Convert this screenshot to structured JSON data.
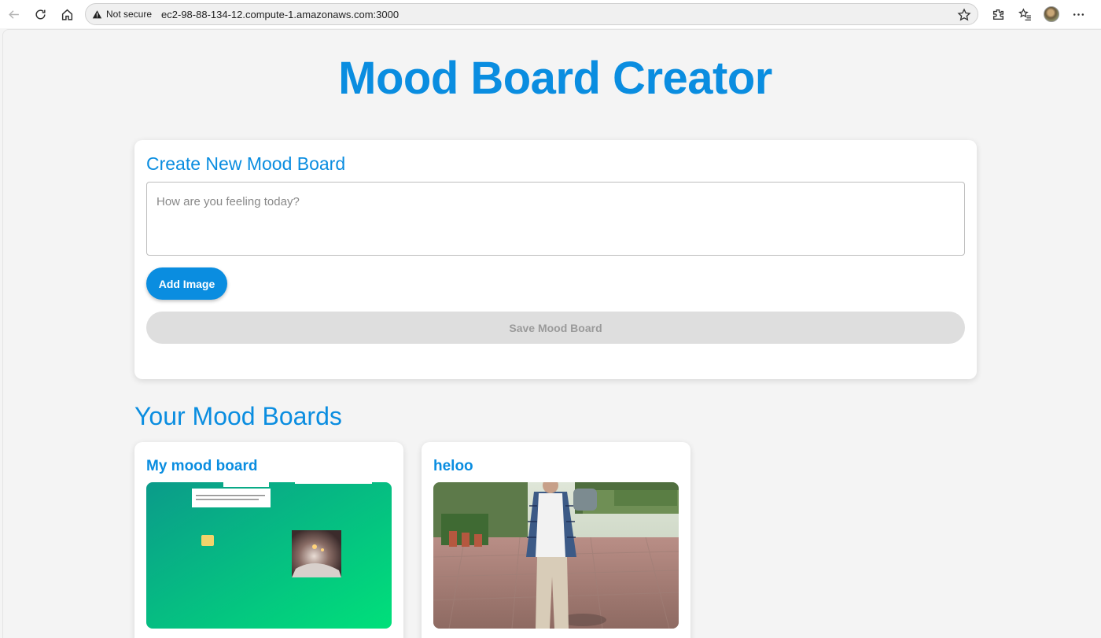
{
  "browser": {
    "security_label": "Not secure",
    "url": "ec2-98-88-134-12.compute-1.amazonaws.com:3000"
  },
  "page": {
    "title": "Mood Board Creator"
  },
  "create": {
    "title": "Create New Mood Board",
    "placeholder": "How are you feeling today?",
    "add_image_label": "Add Image",
    "save_label": "Save Mood Board"
  },
  "boards": {
    "heading": "Your Mood Boards",
    "items": [
      {
        "title": "My mood board"
      },
      {
        "title": "heloo"
      }
    ]
  },
  "colors": {
    "accent": "#0a8de0",
    "background": "#f4f4f4",
    "disabled_button": "#dedede"
  }
}
